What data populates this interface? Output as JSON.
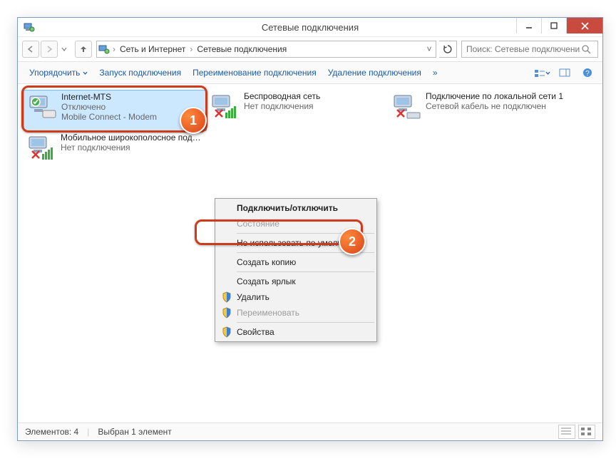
{
  "window": {
    "title": "Сетевые подключения"
  },
  "breadcrumb": {
    "seg1": "Сеть и Интернет",
    "seg2": "Сетевые подключения"
  },
  "search": {
    "placeholder": "Поиск: Сетевые подключения"
  },
  "toolbar": {
    "organize": "Упорядочить",
    "start_conn": "Запуск подключения",
    "rename_conn": "Переименование подключения",
    "delete_conn": "Удаление подключения",
    "overflow": "»"
  },
  "connections": [
    {
      "name": "Internet-MTS",
      "status": "Отключено",
      "detail": "Mobile Connect - Modem"
    },
    {
      "name": "Беспроводная сеть",
      "status": "Нет подключения",
      "detail": ""
    },
    {
      "name": "Подключение по локальной сети 1",
      "status": "Сетевой кабель не подключен",
      "detail": ""
    },
    {
      "name": "Мобильное широкополосное подключение",
      "status": "Нет подключения",
      "detail": ""
    }
  ],
  "context_menu": {
    "connect_disconnect": "Подключить/отключить",
    "state": "Состояние",
    "dont_default": "Не использовать по умолчанию",
    "create_copy": "Создать копию",
    "create_shortcut": "Создать ярлык",
    "delete": "Удалить",
    "rename": "Переименовать",
    "properties": "Свойства"
  },
  "statusbar": {
    "elements": "Элементов: 4",
    "selected": "Выбран 1 элемент"
  },
  "badges": {
    "one": "1",
    "two": "2"
  }
}
